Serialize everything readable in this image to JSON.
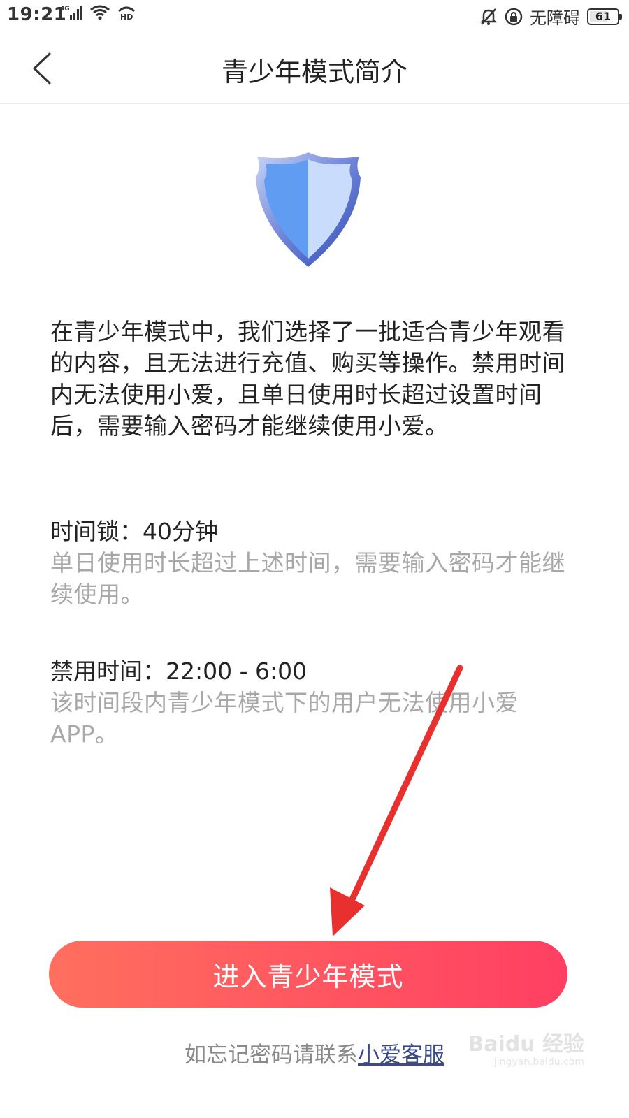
{
  "status_bar": {
    "time": "19:21",
    "network": "4G",
    "hd": "HD",
    "accessibility": "无障碍",
    "battery": "61"
  },
  "nav": {
    "title": "青少年模式简介"
  },
  "intro": "在青少年模式中，我们选择了一批适合青少年观看的内容，且无法进行充值、购买等操作。禁用时间内无法使用小爱，且单日使用时长超过设置时间后，需要输入密码才能继续使用小爱。",
  "time_lock": {
    "heading": "时间锁：40分钟",
    "description": "单日使用时长超过上述时间，需要输入密码才能继续使用。"
  },
  "curfew": {
    "heading": "禁用时间：22:00 - 6:00",
    "description": "该时间段内青少年模式下的用户无法使用小爱APP。"
  },
  "enter_button": "进入青少年模式",
  "footer": {
    "prefix": "如忘记密码请联系",
    "link": "小爱客服"
  },
  "watermark": {
    "brand": "Baidu 经验",
    "url": "jingyan.baidu.com"
  },
  "colors": {
    "button_start": "#ff6f5e",
    "button_end": "#ff3f62",
    "shield_left": "#5f9cf2",
    "shield_right": "#c9dcfb",
    "annotation_arrow": "#e8312f"
  }
}
